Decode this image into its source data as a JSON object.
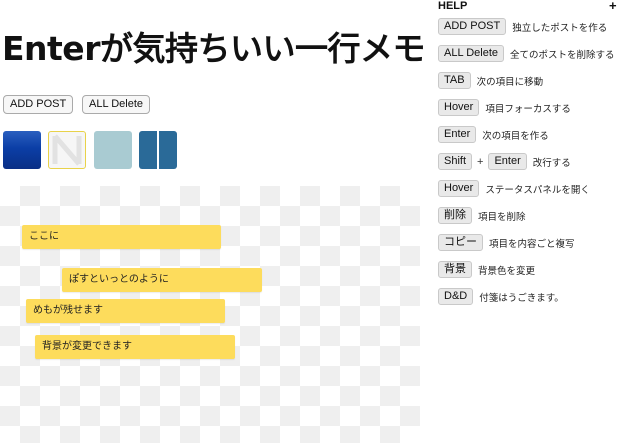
{
  "page": {
    "title": "Enterが気持ちいい一行メモ"
  },
  "toolbar": {
    "add_post_label": "ADD POST",
    "all_delete_label": "ALL Delete"
  },
  "colors": {
    "note": "#fddc5c",
    "swatches": [
      "#0b3ea6",
      "#f6f6f6",
      "#a9cbd2",
      "#2a6a98"
    ]
  },
  "notes": [
    {
      "text": "ここに"
    },
    {
      "text": "ぽすといっとのように"
    },
    {
      "text": "めもが残せます"
    },
    {
      "text": "背景が変更できます"
    }
  ],
  "help": {
    "title": "HELP",
    "toggle": "+",
    "rows": [
      {
        "key": "ADD POST",
        "desc": "独立したポストを作る"
      },
      {
        "key": "ALL Delete",
        "desc": "全てのポストを削除する"
      },
      {
        "key": "TAB",
        "desc": "次の項目に移動"
      },
      {
        "key": "Hover",
        "desc": "項目フォーカスする"
      },
      {
        "key": "Enter",
        "desc": "次の項目を作る"
      },
      {
        "key": "Shift",
        "plus": "+",
        "key2": "Enter",
        "desc": "改行する"
      },
      {
        "key": "Hover",
        "desc": "ステータスパネルを開く"
      },
      {
        "key": "削除",
        "desc": "項目を削除"
      },
      {
        "key": "コピー",
        "desc": "項目を内容ごと複写"
      },
      {
        "key": "背景",
        "desc": "背景色を変更"
      },
      {
        "key": "D&D",
        "desc": "付箋はうごきます。"
      }
    ]
  }
}
